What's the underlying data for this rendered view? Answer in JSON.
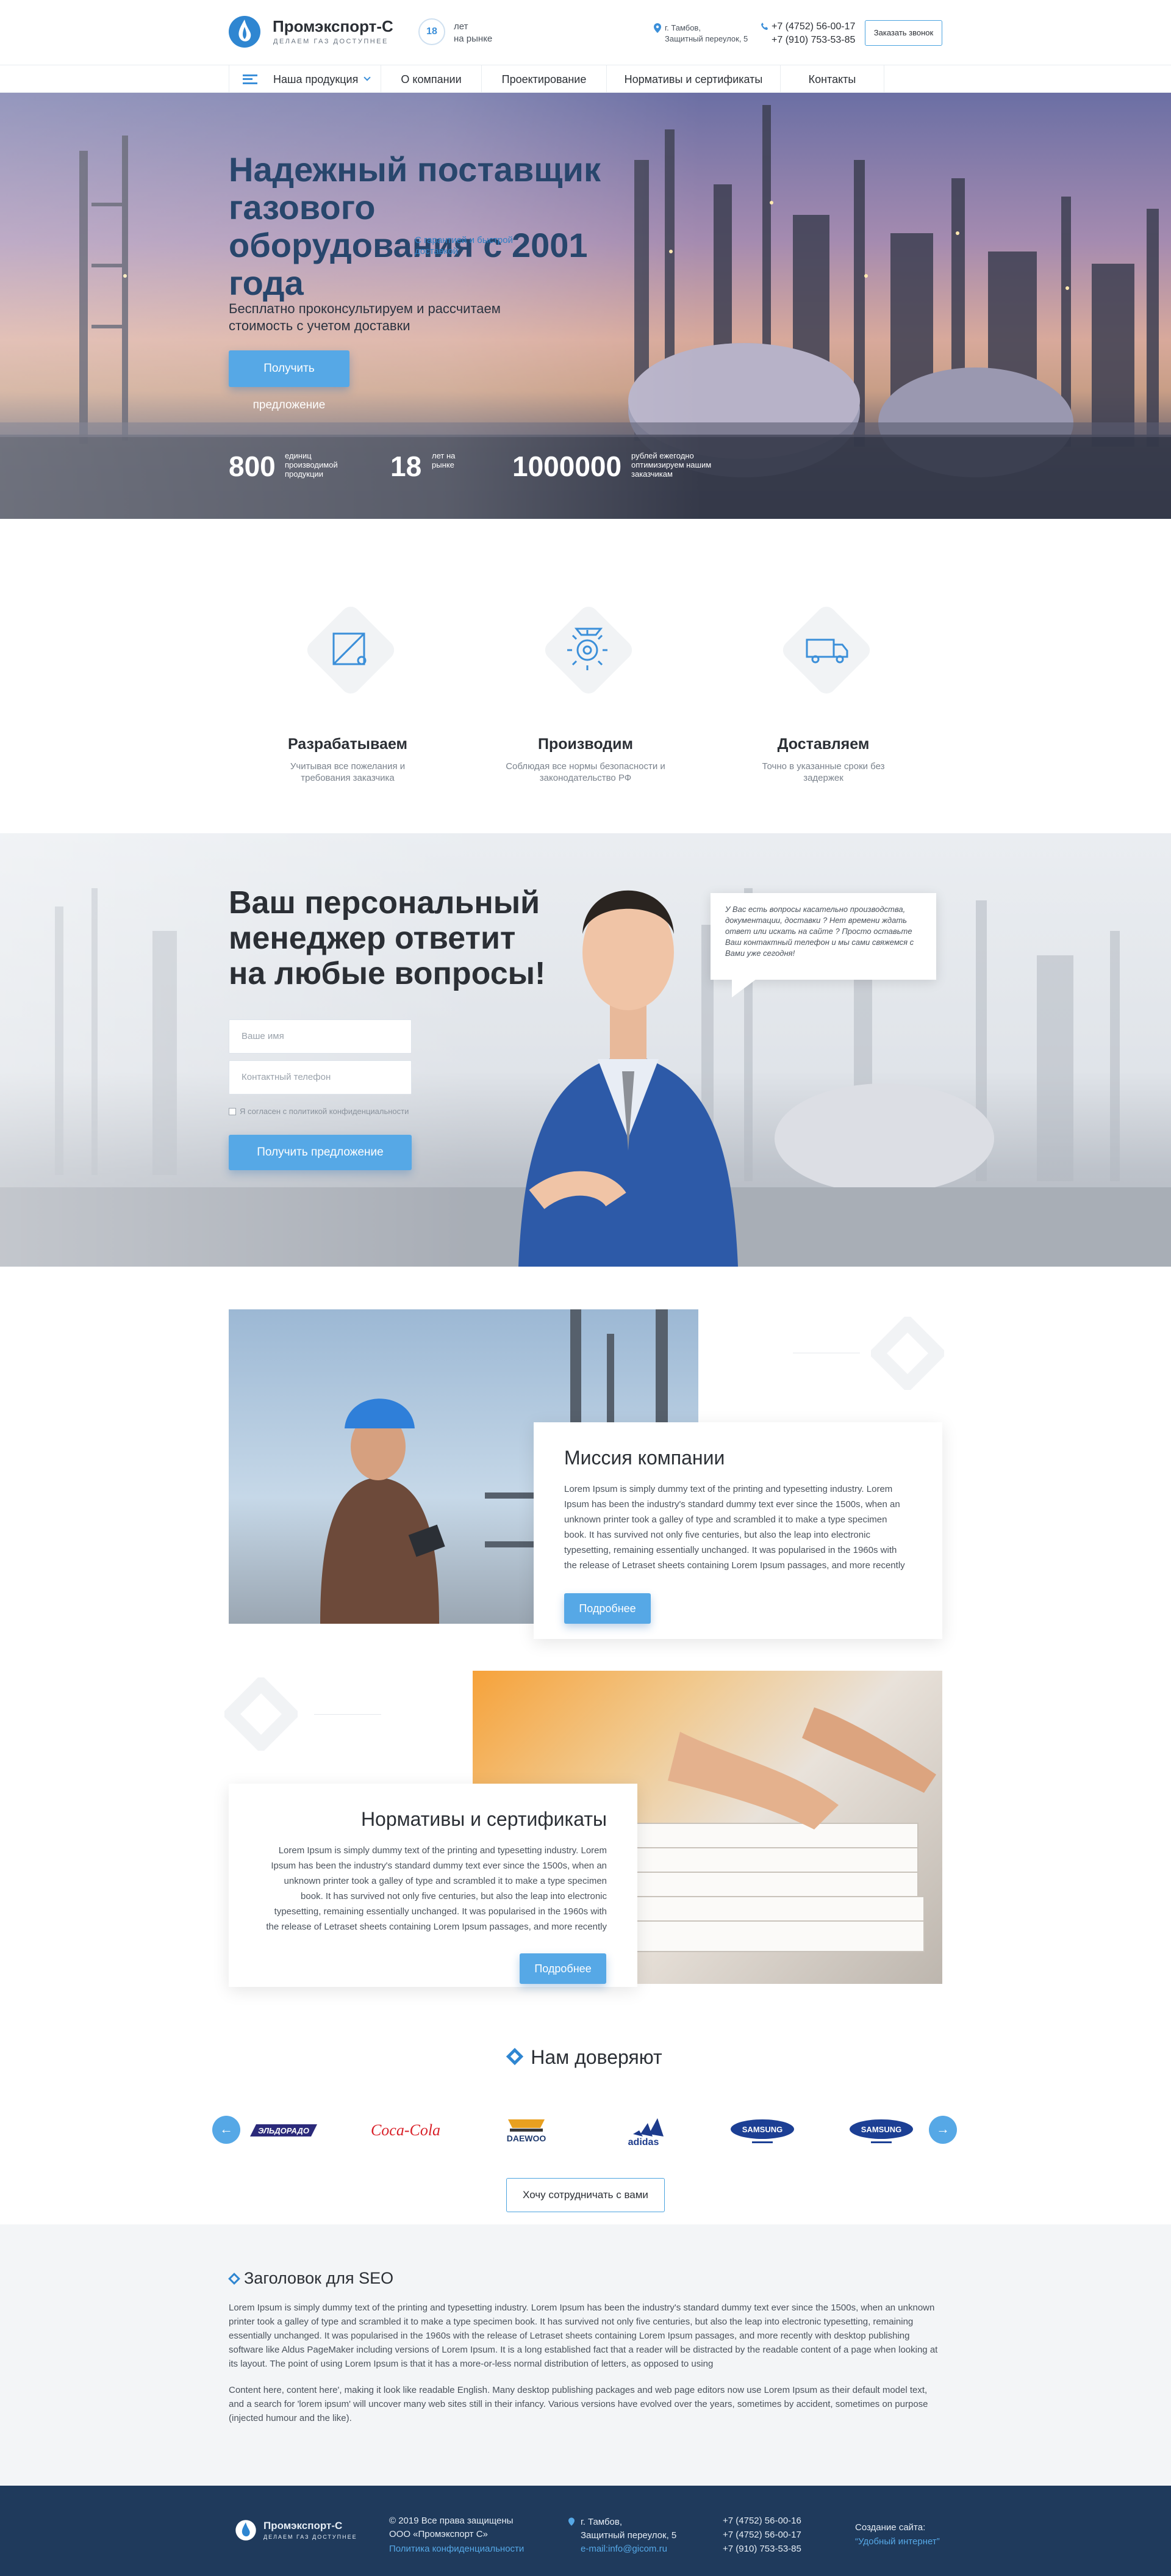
{
  "header": {
    "brand": "Промэкспорт-С",
    "slogan": "Делаем газ доступнее",
    "years_number": "18",
    "years_text": "лет\nна рынке",
    "address": "г. Тамбов,\nЗащитный переулок, 5",
    "phone1": "+7 (4752) 56-00-17",
    "phone2": "+7 (910) 753-53-85",
    "callback_label": "Заказать звонок"
  },
  "nav": {
    "products": "Наша продукция",
    "about": "О компании",
    "design": "Проектирование",
    "normatives": "Нормативы и сертификаты",
    "contacts": "Контакты"
  },
  "hero": {
    "title": "Надежный поставщик газового оборудования с 2001 года",
    "tagline": "С гарантией и быстрой доставкой",
    "subtitle": "Бесплатно проконсультируем и рассчитаем стоимость с учетом доставки",
    "cta": "Получить предложение",
    "stats": [
      {
        "number": "800",
        "label": "единиц производимой продукции"
      },
      {
        "number": "18",
        "label": "лет на рынке"
      },
      {
        "number": "1000000",
        "label": "рублей ежегодно оптимизируем нашим заказчикам"
      }
    ]
  },
  "features": [
    {
      "title": "Разрабатываем",
      "desc": "Учитывая все пожелания и требования заказчика",
      "icon": "design-tools-icon"
    },
    {
      "title": "Производим",
      "desc": "Соблюдая все нормы безопасности и законодательство РФ",
      "icon": "production-gear-icon"
    },
    {
      "title": "Доставляем",
      "desc": "Точно в указанные сроки без задержек",
      "icon": "delivery-truck-icon"
    }
  ],
  "manager": {
    "title": "Ваш персональный менеджер ответит на любые вопросы!",
    "name_placeholder": "Ваше имя",
    "phone_placeholder": "Контактный телефон",
    "agree": "Я согласен с политикой конфиденциальности",
    "submit": "Получить предложение",
    "bubble": "У Вас есть вопросы касательно производства, документации, доставки ? Нет времени ждать ответ или искать на сайте ? Просто оставьте Ваш контактный телефон и мы сами свяжемся с Вами уже сегодня!"
  },
  "mission": {
    "title": "Миссия компании",
    "text": "Lorem Ipsum is simply dummy text of the printing and typesetting industry. Lorem Ipsum has been the industry's standard dummy text ever since the 1500s, when an unknown printer took a galley of type and scrambled it to make a type specimen book. It has survived not only five centuries, but also the leap into electronic typesetting, remaining essentially unchanged. It was popularised in the 1960s with the release of Letraset sheets containing Lorem Ipsum passages, and more recently",
    "more": "Подробнее"
  },
  "norms": {
    "title": "Нормативы и сертификаты",
    "text": "Lorem Ipsum is simply dummy text of the printing and typesetting industry. Lorem Ipsum has been the industry's standard dummy text ever since the 1500s, when an unknown printer took a galley of type and scrambled it to make a type specimen book. It has survived not only five centuries, but also the leap into electronic typesetting, remaining essentially unchanged. It was popularised in the 1960s with the release of Letraset sheets containing Lorem Ipsum passages, and more recently",
    "more": "Подробнее"
  },
  "trust": {
    "title": "Нам доверяют",
    "brands": [
      "ЭЛЬДОРАДО",
      "Coca-Cola",
      "DAEWOO",
      "adidas",
      "SAMSUNG",
      "SAMSUNG"
    ],
    "cooperate": "Хочу сотрудничать с вами"
  },
  "seo": {
    "title": "Заголовок для SEO",
    "p1": "Lorem Ipsum is simply dummy text of the printing and typesetting industry. Lorem Ipsum has been the industry's standard dummy text ever since the 1500s, when an unknown printer took a galley of type and scrambled it to make a type specimen book. It has survived not only five centuries, but also the leap into electronic typesetting, remaining essentially unchanged. It was popularised in the 1960s with the release of Letraset sheets containing Lorem Ipsum passages, and more recently with desktop publishing software like Aldus PageMaker including versions of Lorem Ipsum. It is a long established fact that a reader will be distracted by the readable content of a page when looking at its layout. The point of using Lorem Ipsum is that it has a more-or-less normal distribution of letters, as opposed to using",
    "p2": "Content here, content here', making it look like readable English. Many desktop publishing packages and web page editors now use Lorem Ipsum as their default model text, and a search for 'lorem ipsum' will uncover many web sites still in their infancy. Various versions have evolved over the years, sometimes by accident, sometimes on purpose (injected humour and the like)."
  },
  "footer": {
    "brand": "Промэкспорт-С",
    "slogan": "Делаем газ доступнее",
    "copyright": "© 2019 Все права защищены\nООО «Промэкспорт С»",
    "privacy": "Политика конфиденциальности",
    "address": "г. Тамбов,\nЗащитный переулок, 5",
    "email": "e-mail:info@gicom.ru",
    "phone1": "+7 (4752) 56-00-16",
    "phone2": "+7 (4752) 56-00-17",
    "phone3": "+7 (910) 753-53-85",
    "created_label": "Создание сайта:",
    "created_by": "“Удобный интернет”"
  },
  "colors": {
    "accent": "#56a8e6",
    "dark_blue": "#28466c",
    "footer": "#1f3a5c"
  }
}
